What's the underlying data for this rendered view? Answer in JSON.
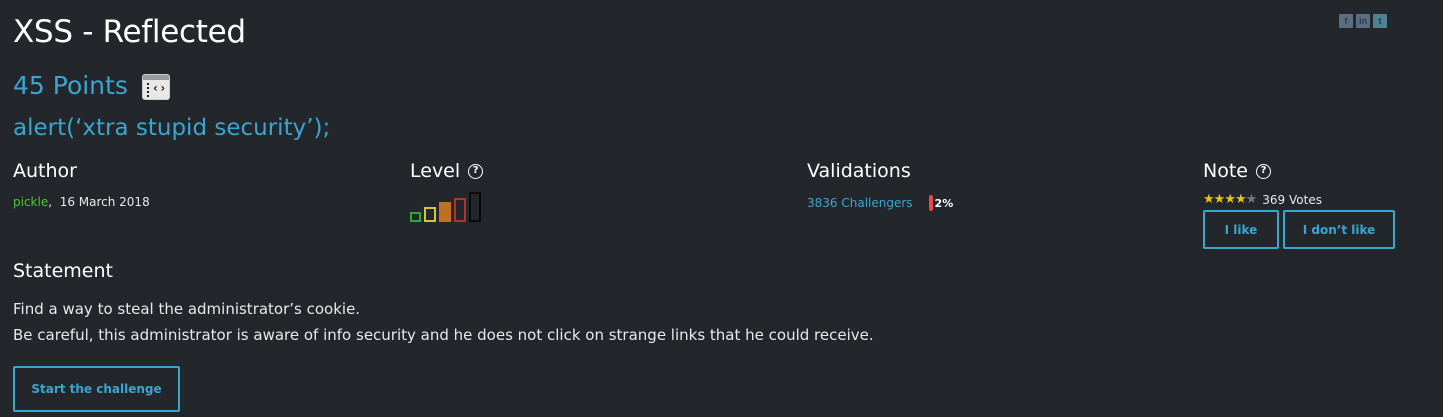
{
  "challenge": {
    "title": "XSS - Reflected",
    "points": "45 Points",
    "subtitle": "alert(‘xtra stupid security’);",
    "category_icon": "web-client-icon"
  },
  "share": [
    "f",
    "in",
    "t"
  ],
  "author": {
    "heading": "Author",
    "name": "pickle",
    "separator": ",",
    "date": "16 March 2018"
  },
  "level": {
    "heading": "Level",
    "help_icon": "?",
    "difficulty": 3,
    "max": 5,
    "colors": [
      "#2ea83a",
      "#d1c637",
      "#c1701f",
      "#b23427",
      "#0a0a0a"
    ]
  },
  "validations": {
    "heading": "Validations",
    "challengers": "3836 Challengers",
    "percent": "2%",
    "percent_value": 0.02
  },
  "note": {
    "heading": "Note",
    "help_icon": "?",
    "rating": 4,
    "max": 5,
    "votes": "369 Votes",
    "like_label": "I like",
    "dislike_label": "I don’t like"
  },
  "statement": {
    "heading": "Statement",
    "line1": "Find a way to steal the administrator’s cookie.",
    "line2": "Be careful, this administrator is aware of info security and he does not click on strange links that he could receive."
  },
  "start_label": "Start the challenge",
  "colors": {
    "background": "#23262b",
    "accent": "#3aa6cf",
    "author_name": "#4ec33a",
    "star": "#e5c21c",
    "percent_bar": "#e5484d"
  }
}
